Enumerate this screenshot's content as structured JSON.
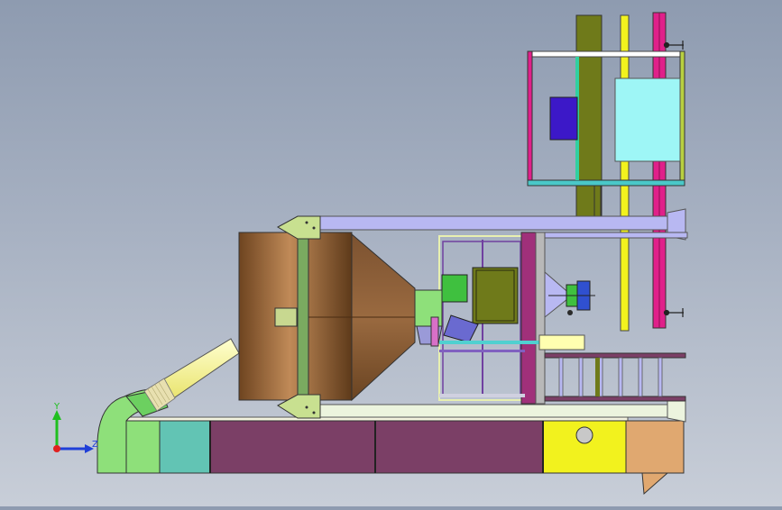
{
  "viewport": {
    "background_top": "#8e9bb0",
    "background_bottom": "#c8ced8"
  },
  "triad": {
    "y_label": "Y",
    "z_label": "Z",
    "y_color": "#1fbf1f",
    "z_color": "#1f3fd8",
    "x_color": "#e02020"
  },
  "parts": {
    "drum_color": "#9a6a3c",
    "cone_color": "#8c5f36",
    "duct_plum": "#7b3f66",
    "duct_teal": "#62c4b4",
    "duct_green": "#8ee07a",
    "duct_yellow": "#f2f21e",
    "duct_tan": "#e0a870",
    "beam_lavender": "#b8b8f2",
    "beam_pale": "#ecf4de",
    "frame_magenta": "#e0208a",
    "frame_olive": "#6f7a1a",
    "panel_cyan": "#9ef6f6",
    "panel_blue": "#3c18c8",
    "post_yellow": "#f2f21e",
    "motor_green": "#3fc03f"
  }
}
